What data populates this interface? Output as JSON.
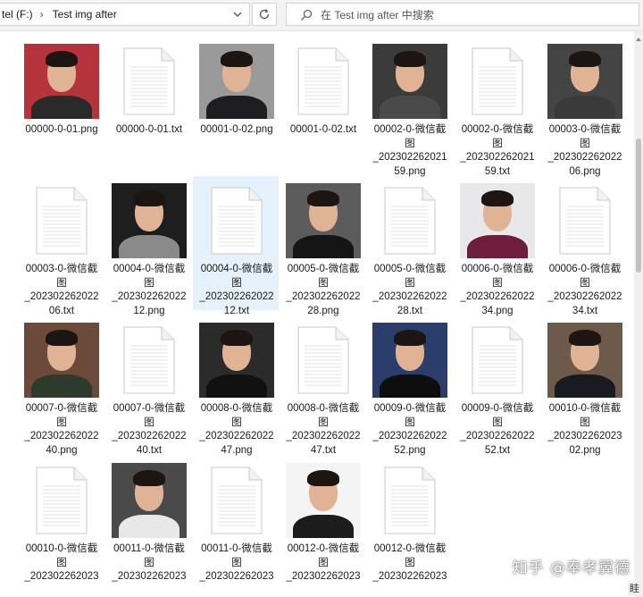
{
  "address": {
    "drive": "tel (F:)",
    "separator": "›",
    "folder": "Test img after"
  },
  "search": {
    "placeholder": "在 Test img after 中搜索"
  },
  "files": [
    {
      "type": "png",
      "lines": [
        "00000-0-01.png"
      ],
      "bg": "#b5343b",
      "body": "#2a2a2a"
    },
    {
      "type": "txt",
      "lines": [
        "00000-0-01.txt"
      ]
    },
    {
      "type": "png",
      "lines": [
        "00001-0-02.png"
      ],
      "bg": "#9a9a9a",
      "body": "#1e1e22"
    },
    {
      "type": "txt",
      "lines": [
        "00001-0-02.txt"
      ]
    },
    {
      "type": "png",
      "lines": [
        "00002-0-微信截",
        "图",
        "_202302262021",
        "59.png"
      ],
      "bg": "#3b3b3b",
      "body": "#4a4a4a"
    },
    {
      "type": "txt",
      "lines": [
        "00002-0-微信截",
        "图",
        "_202302262021",
        "59.txt"
      ]
    },
    {
      "type": "png",
      "lines": [
        "00003-0-微信截",
        "图",
        "_202302262022",
        "06.png"
      ],
      "bg": "#444444",
      "body": "#3a3a3a"
    },
    {
      "type": "txt",
      "lines": [
        "00003-0-微信截",
        "图",
        "_202302262022",
        "06.txt"
      ]
    },
    {
      "type": "png",
      "lines": [
        "00004-0-微信截",
        "图",
        "_202302262022",
        "12.png"
      ],
      "bg": "#1e1e1e",
      "body": "#8a8a8a"
    },
    {
      "type": "txt",
      "lines": [
        "00004-0-微信截",
        "图",
        "_202302262022",
        "12.txt"
      ],
      "selected": true
    },
    {
      "type": "png",
      "lines": [
        "00005-0-微信截",
        "图",
        "_202302262022",
        "28.png"
      ],
      "bg": "#5c5c5c",
      "body": "#151515"
    },
    {
      "type": "txt",
      "lines": [
        "00005-0-微信截",
        "图",
        "_202302262022",
        "28.txt"
      ]
    },
    {
      "type": "png",
      "lines": [
        "00006-0-微信截",
        "图",
        "_202302262022",
        "34.png"
      ],
      "bg": "#e8e8ea",
      "body": "#6e1e3a"
    },
    {
      "type": "txt",
      "lines": [
        "00006-0-微信截",
        "图",
        "_202302262022",
        "34.txt"
      ]
    },
    {
      "type": "png",
      "lines": [
        "00007-0-微信截",
        "图",
        "_202302262022",
        "40.png"
      ],
      "bg": "#6b4a3a",
      "body": "#2e3a2c"
    },
    {
      "type": "txt",
      "lines": [
        "00007-0-微信截",
        "图",
        "_202302262022",
        "40.txt"
      ]
    },
    {
      "type": "png",
      "lines": [
        "00008-0-微信截",
        "图",
        "_202302262022",
        "47.png"
      ],
      "bg": "#2b2b2b",
      "body": "#111111"
    },
    {
      "type": "txt",
      "lines": [
        "00008-0-微信截",
        "图",
        "_202302262022",
        "47.txt"
      ]
    },
    {
      "type": "png",
      "lines": [
        "00009-0-微信截",
        "图",
        "_202302262022",
        "52.png"
      ],
      "bg": "#2a3d6b",
      "body": "#0e0e0e"
    },
    {
      "type": "txt",
      "lines": [
        "00009-0-微信截",
        "图",
        "_202302262022",
        "52.txt"
      ]
    },
    {
      "type": "png",
      "lines": [
        "00010-0-微信截",
        "图",
        "_202302262023",
        "02.png"
      ],
      "bg": "#6d5a4b",
      "body": "#1a1a22"
    },
    {
      "type": "txt",
      "lines": [
        "00010-0-微信截",
        "图",
        "_202302262023"
      ]
    },
    {
      "type": "png",
      "lines": [
        "00011-0-微信截",
        "图",
        "_202302262023"
      ],
      "bg": "#4a4a4a",
      "body": "#e8e8e8"
    },
    {
      "type": "txt",
      "lines": [
        "00011-0-微信截",
        "图",
        "_202302262023"
      ]
    },
    {
      "type": "png",
      "lines": [
        "00012-0-微信截",
        "图",
        "_202302262023"
      ],
      "bg": "#f4f4f4",
      "body": "#1c1c1c"
    },
    {
      "type": "txt",
      "lines": [
        "00012-0-微信截",
        "图",
        "_202302262023"
      ]
    }
  ],
  "watermark": "知乎 @奉孝翼德",
  "corner_text": "眭"
}
